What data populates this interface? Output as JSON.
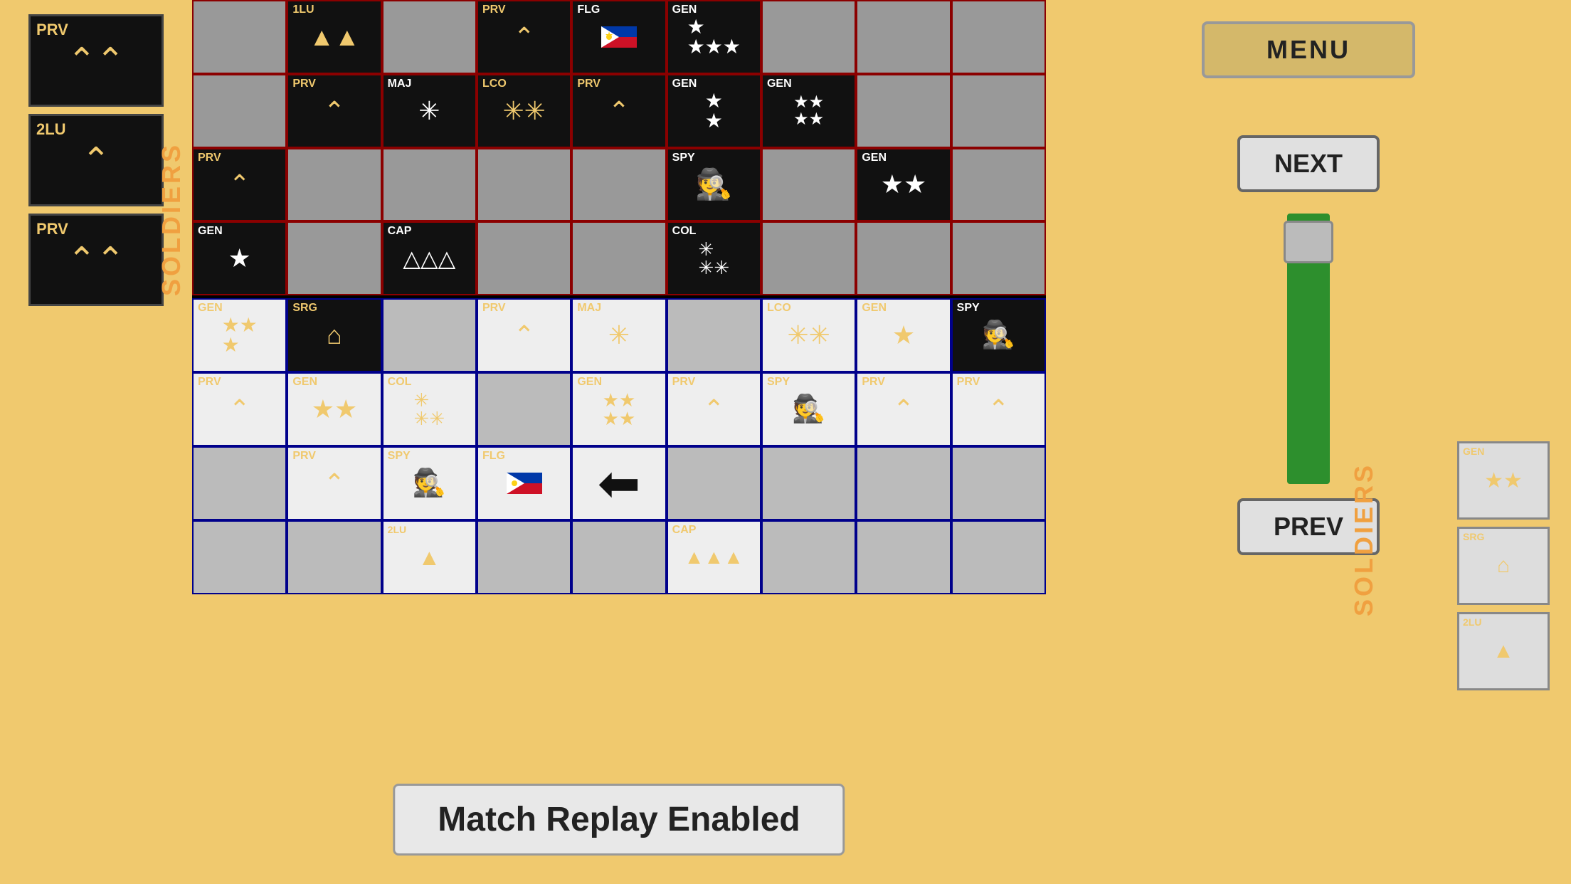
{
  "left_sidebar": {
    "cards": [
      {
        "rank": "PRV",
        "symbol": "^^",
        "type": "double-chevron"
      },
      {
        "rank": "2LU",
        "symbol": "^",
        "type": "single-chevron"
      },
      {
        "rank": "PRV",
        "symbol": "^^",
        "type": "double-chevron-alt"
      }
    ],
    "soldiers_label": "SOLDIERS"
  },
  "menu_button": {
    "label": "MENU"
  },
  "next_button": {
    "label": "NEXT"
  },
  "prev_button": {
    "label": "PREV"
  },
  "notification": {
    "text": "Match Replay Enabled"
  },
  "soldiers_right_label": "SOLDIERS",
  "mini_cards": [
    {
      "rank": "GEN",
      "symbol": "★★",
      "color": "yellow"
    },
    {
      "rank": "SRG",
      "symbol": "⌂",
      "color": "yellow"
    },
    {
      "rank": "2LU",
      "symbol": "▲",
      "color": "yellow"
    }
  ],
  "enemy_cells": [
    {
      "rank": "",
      "sym": "",
      "bg": "gray"
    },
    {
      "rank": "1LU",
      "sym": "▲▲",
      "bg": "black",
      "symColor": "yellow",
      "rankColor": "yellow"
    },
    {
      "rank": "",
      "sym": "",
      "bg": "gray"
    },
    {
      "rank": "PRV",
      "sym": "^",
      "bg": "black",
      "symColor": "yellow",
      "rankColor": "yellow"
    },
    {
      "rank": "FLG",
      "sym": "🏳",
      "bg": "black",
      "symColor": "white",
      "rankColor": "white"
    },
    {
      "rank": "GEN",
      "sym": "★★★★",
      "bg": "black",
      "symColor": "white",
      "rankColor": "white"
    },
    {
      "rank": "",
      "sym": "",
      "bg": "gray"
    },
    {
      "rank": "",
      "sym": "",
      "bg": "gray"
    },
    {
      "rank": "",
      "sym": "",
      "bg": "gray"
    },
    {
      "rank": "",
      "sym": "",
      "bg": "gray"
    },
    {
      "rank": "PRV",
      "sym": "^",
      "bg": "black",
      "symColor": "yellow",
      "rankColor": "yellow"
    },
    {
      "rank": "MAJ",
      "sym": "✳",
      "bg": "black",
      "symColor": "white",
      "rankColor": "white"
    },
    {
      "rank": "LCO",
      "sym": "✳✳",
      "bg": "black",
      "symColor": "yellow",
      "rankColor": "yellow"
    },
    {
      "rank": "PRV",
      "sym": "^",
      "bg": "black",
      "symColor": "yellow",
      "rankColor": "yellow"
    },
    {
      "rank": "GEN",
      "sym": "★★",
      "bg": "black",
      "symColor": "white",
      "rankColor": "white"
    },
    {
      "rank": "GEN",
      "sym": "★★★★",
      "bg": "black",
      "symColor": "white",
      "rankColor": "white"
    },
    {
      "rank": "",
      "sym": "",
      "bg": "gray"
    },
    {
      "rank": "",
      "sym": "",
      "bg": "gray"
    },
    {
      "rank": "PRV",
      "sym": "^",
      "bg": "black",
      "symColor": "yellow",
      "rankColor": "yellow"
    },
    {
      "rank": "",
      "sym": "",
      "bg": "gray"
    },
    {
      "rank": "",
      "sym": "",
      "bg": "gray"
    },
    {
      "rank": "",
      "sym": "",
      "bg": "gray"
    },
    {
      "rank": "",
      "sym": "",
      "bg": "gray"
    },
    {
      "rank": "SPY",
      "sym": "🕵",
      "bg": "black",
      "symColor": "white",
      "rankColor": "white"
    },
    {
      "rank": "",
      "sym": "",
      "bg": "gray"
    },
    {
      "rank": "GEN",
      "sym": "★★",
      "bg": "black",
      "symColor": "white",
      "rankColor": "white"
    },
    {
      "rank": "",
      "sym": "",
      "bg": "gray"
    },
    {
      "rank": "GEN",
      "sym": "★",
      "bg": "black",
      "symColor": "white",
      "rankColor": "white"
    },
    {
      "rank": "",
      "sym": "",
      "bg": "gray"
    },
    {
      "rank": "CAP",
      "sym": "▲▲▲",
      "bg": "black",
      "symColor": "white",
      "rankColor": "white"
    },
    {
      "rank": "",
      "sym": "",
      "bg": "gray"
    },
    {
      "rank": "",
      "sym": "",
      "bg": "gray"
    },
    {
      "rank": "COL",
      "sym": "✳✳✳",
      "bg": "black",
      "symColor": "white",
      "rankColor": "white"
    },
    {
      "rank": "",
      "sym": "",
      "bg": "gray"
    },
    {
      "rank": "",
      "sym": "",
      "bg": "gray"
    },
    {
      "rank": "",
      "sym": "",
      "bg": "gray"
    }
  ],
  "player_cells": [
    {
      "rank": "GEN",
      "sym": "★★★",
      "bg": "white",
      "symColor": "yellow",
      "rankColor": "yellow"
    },
    {
      "rank": "SRG",
      "sym": "⌂",
      "bg": "black",
      "symColor": "yellow",
      "rankColor": "yellow"
    },
    {
      "rank": "",
      "sym": "",
      "bg": "gray"
    },
    {
      "rank": "PRV",
      "sym": "^",
      "bg": "white",
      "symColor": "yellow",
      "rankColor": "yellow"
    },
    {
      "rank": "MAJ",
      "sym": "✳",
      "bg": "white",
      "symColor": "yellow",
      "rankColor": "yellow"
    },
    {
      "rank": "",
      "sym": "",
      "bg": "gray"
    },
    {
      "rank": "LCO",
      "sym": "✳✳",
      "bg": "white",
      "symColor": "yellow",
      "rankColor": "yellow"
    },
    {
      "rank": "GEN",
      "sym": "★",
      "bg": "white",
      "symColor": "yellow",
      "rankColor": "yellow"
    },
    {
      "rank": "SPY",
      "sym": "🕵",
      "bg": "black",
      "symColor": "black",
      "rankColor": "white"
    },
    {
      "rank": "PRV",
      "sym": "^",
      "bg": "white",
      "symColor": "yellow",
      "rankColor": "yellow"
    },
    {
      "rank": "GEN",
      "sym": "★★",
      "bg": "white",
      "symColor": "yellow",
      "rankColor": "yellow"
    },
    {
      "rank": "COL",
      "sym": "✳✳✳",
      "bg": "white",
      "symColor": "yellow",
      "rankColor": "yellow"
    },
    {
      "rank": "",
      "sym": "",
      "bg": "gray"
    },
    {
      "rank": "GEN",
      "sym": "★★★★",
      "bg": "white",
      "symColor": "yellow",
      "rankColor": "yellow"
    },
    {
      "rank": "PRV",
      "sym": "^",
      "bg": "white",
      "symColor": "yellow",
      "rankColor": "yellow"
    },
    {
      "rank": "SPY",
      "sym": "🕵",
      "bg": "white",
      "symColor": "black",
      "rankColor": "yellow"
    },
    {
      "rank": "PRV",
      "sym": "^",
      "bg": "white",
      "symColor": "yellow",
      "rankColor": "yellow"
    },
    {
      "rank": "PRV",
      "sym": "^",
      "bg": "white",
      "symColor": "yellow",
      "rankColor": "yellow"
    },
    {
      "rank": "",
      "sym": "",
      "bg": "gray"
    },
    {
      "rank": "PRV",
      "sym": "^",
      "bg": "white",
      "symColor": "yellow",
      "rankColor": "yellow"
    },
    {
      "rank": "SPY",
      "sym": "🕵",
      "bg": "white",
      "symColor": "black",
      "rankColor": "yellow"
    },
    {
      "rank": "FLG",
      "sym": "🏳",
      "bg": "white",
      "symColor": "",
      "rankColor": "yellow"
    },
    {
      "rank": "",
      "sym": "←",
      "bg": "white",
      "symColor": "black",
      "rankColor": ""
    },
    {
      "rank": "",
      "sym": "",
      "bg": "gray"
    },
    {
      "rank": "",
      "sym": "",
      "bg": "gray"
    },
    {
      "rank": "",
      "sym": "",
      "bg": "gray"
    },
    {
      "rank": "",
      "sym": "",
      "bg": "gray"
    },
    {
      "rank": "",
      "sym": "",
      "bg": "gray"
    },
    {
      "rank": "",
      "sym": "",
      "bg": "gray"
    },
    {
      "rank": "2LU",
      "sym": "▲",
      "bg": "white",
      "symColor": "yellow",
      "rankColor": "yellow"
    },
    {
      "rank": "",
      "sym": "",
      "bg": "gray"
    },
    {
      "rank": "",
      "sym": "",
      "bg": "gray"
    },
    {
      "rank": "CAP",
      "sym": "▲▲▲",
      "bg": "white",
      "symColor": "yellow",
      "rankColor": "yellow"
    },
    {
      "rank": "",
      "sym": "",
      "bg": "gray"
    },
    {
      "rank": "",
      "sym": "",
      "bg": "gray"
    },
    {
      "rank": "",
      "sym": "",
      "bg": "gray"
    }
  ]
}
